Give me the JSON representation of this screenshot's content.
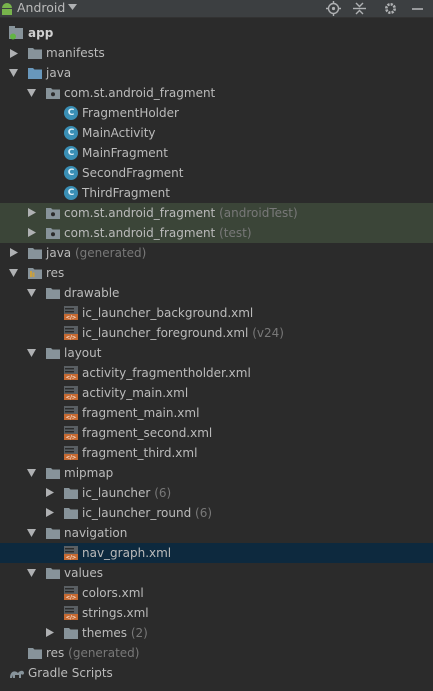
{
  "toolbar": {
    "view_label": "Android",
    "icons": [
      "android-icon",
      "dropdown-caret-icon",
      "locate-icon",
      "collapse-all-icon",
      "gear-icon",
      "minimize-icon"
    ]
  },
  "tree": {
    "app": "app",
    "manifests": "manifests",
    "java": "java",
    "pkg_main": "com.st.android_fragment",
    "classes": [
      "FragmentHolder",
      "MainActivity",
      "MainFragment",
      "SecondFragment",
      "ThirdFragment"
    ],
    "pkg_android_test": "com.st.android_fragment",
    "pkg_android_test_tag": "(androidTest)",
    "pkg_test": "com.st.android_fragment",
    "pkg_test_tag": "(test)",
    "java_generated": "java",
    "java_generated_tag": "(generated)",
    "res": "res",
    "drawable": "drawable",
    "drawable_files": [
      "ic_launcher_background.xml",
      "ic_launcher_foreground.xml"
    ],
    "drawable_file2_tag": "(v24)",
    "layout": "layout",
    "layout_files": [
      "activity_fragmentholder.xml",
      "activity_main.xml",
      "fragment_main.xml",
      "fragment_second.xml",
      "fragment_third.xml"
    ],
    "mipmap": "mipmap",
    "ic_launcher": "ic_launcher",
    "ic_launcher_count": "(6)",
    "ic_launcher_round": "ic_launcher_round",
    "ic_launcher_round_count": "(6)",
    "navigation": "navigation",
    "nav_graph": "nav_graph.xml",
    "values": "values",
    "values_files": [
      "colors.xml",
      "strings.xml"
    ],
    "themes": "themes",
    "themes_count": "(2)",
    "res_generated": "res",
    "res_generated_tag": "(generated)",
    "gradle_scripts": "Gradle Scripts"
  },
  "colors": {
    "background": "#2b2b2b",
    "selection": "#0d293e",
    "test_highlight": "#3b4538",
    "class_icon": "#3a8fb5",
    "xml_icon": "#c76a32",
    "folder": "#87939a"
  }
}
